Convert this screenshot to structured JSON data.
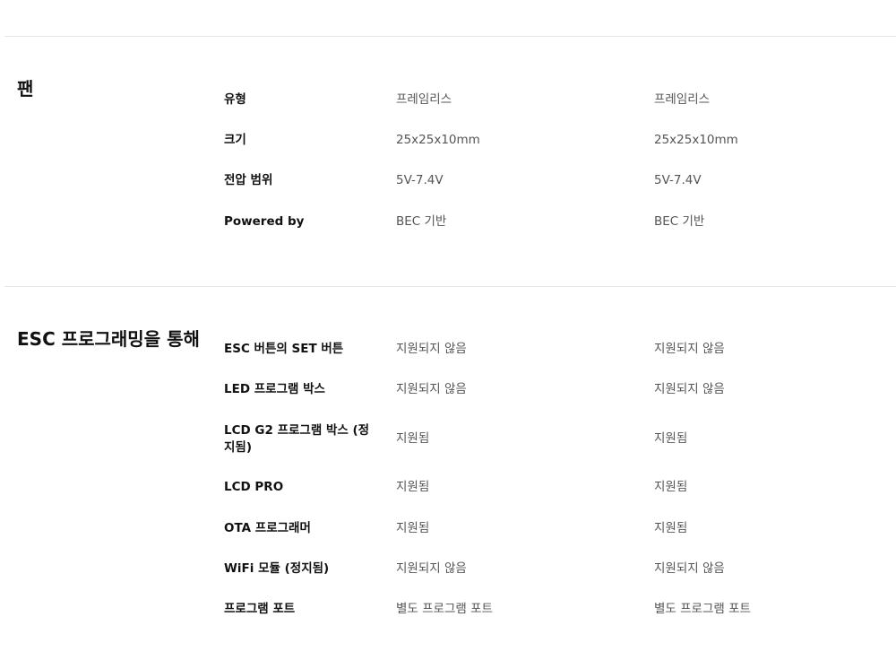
{
  "sections": [
    {
      "title": "팬",
      "rows": [
        {
          "label": "유형",
          "v1": "프레임리스",
          "v2": "프레임리스"
        },
        {
          "label": "크기",
          "v1": "25x25x10mm",
          "v2": "25x25x10mm"
        },
        {
          "label": "전압 범위",
          "v1": "5V-7.4V",
          "v2": "5V-7.4V"
        },
        {
          "label": "Powered by",
          "v1": "BEC 기반",
          "v2": "BEC 기반"
        }
      ]
    },
    {
      "title": "ESC 프로그래밍을 통해",
      "rows": [
        {
          "label": "ESC 버튼의 SET 버튼",
          "v1": "지원되지 않음",
          "v2": "지원되지 않음"
        },
        {
          "label": "LED 프로그램 박스",
          "v1": "지원되지 않음",
          "v2": "지원되지 않음"
        },
        {
          "label": "LCD G2 프로그램 박스 (정지됨)",
          "v1": "지원됨",
          "v2": "지원됨"
        },
        {
          "label": "LCD PRO",
          "v1": "지원됨",
          "v2": "지원됨"
        },
        {
          "label": "OTA 프로그래머",
          "v1": "지원됨",
          "v2": "지원됨"
        },
        {
          "label": "WiFi 모듈 (정지됨)",
          "v1": "지원되지 않음",
          "v2": "지원되지 않음"
        },
        {
          "label": "프로그램 포트",
          "v1": "별도 프로그램 포트",
          "v2": "별도 프로그램 포트"
        }
      ]
    }
  ]
}
